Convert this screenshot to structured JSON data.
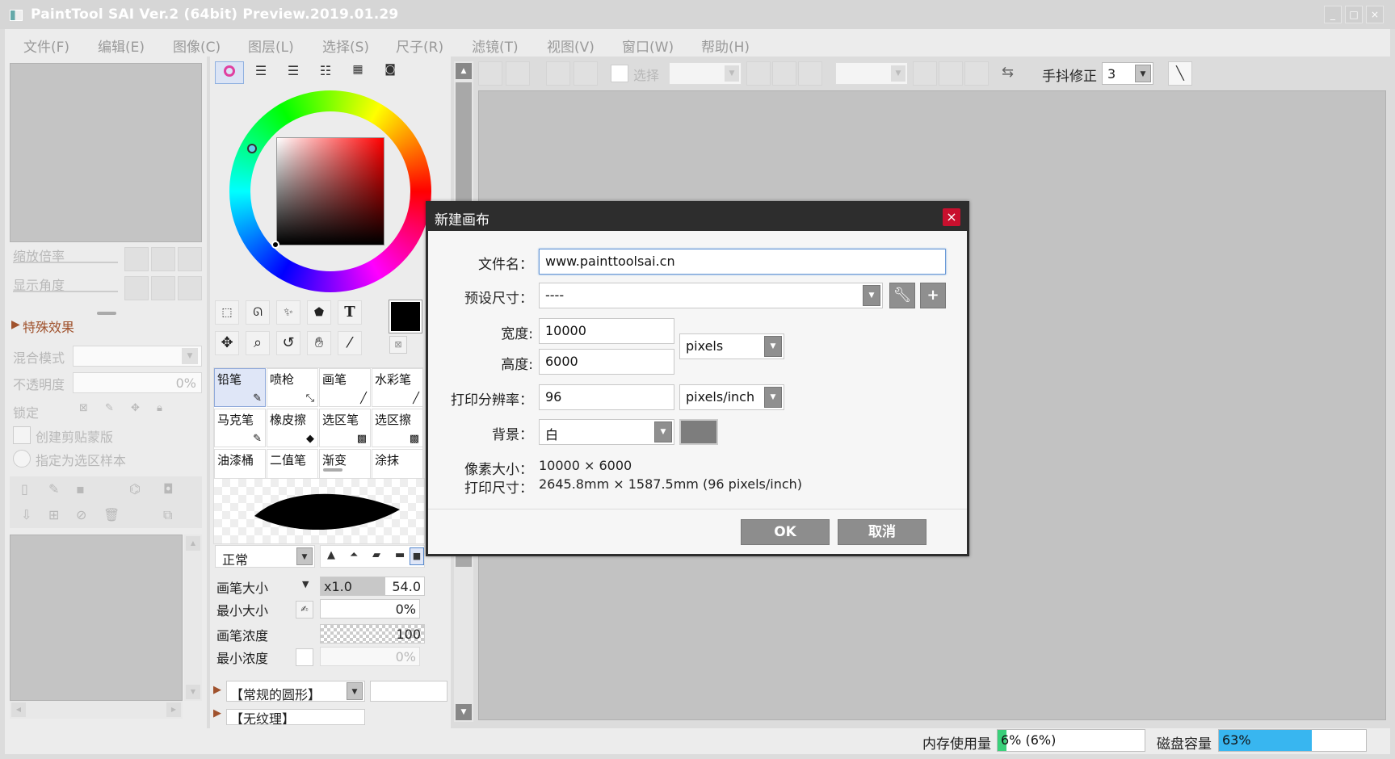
{
  "window": {
    "title": "PaintTool SAI Ver.2 (64bit) Preview.2019.01.29",
    "controls": [
      "_",
      "□",
      "×"
    ]
  },
  "menu": [
    "文件(F)",
    "编辑(E)",
    "图像(C)",
    "图层(L)",
    "选择(S)",
    "尺子(R)",
    "滤镜(T)",
    "视图(V)",
    "窗口(W)",
    "帮助(H)"
  ],
  "toolbar": {
    "select_label": "选择",
    "stabilizer_label": "手抖修正",
    "stabilizer_value": "3"
  },
  "navigator": {
    "zoom_label": "缩放倍率",
    "angle_label": "显示角度"
  },
  "layer_panel": {
    "effects_label": "特殊效果",
    "blend_label": "混合模式",
    "opacity_label": "不透明度",
    "opacity_value": "0%",
    "lock_label": "锁定",
    "clip_label": "创建剪贴蒙版",
    "sample_label": "指定为选区样本"
  },
  "brushes": {
    "row1": [
      "铅笔",
      "喷枪",
      "画笔",
      "水彩笔"
    ],
    "row2": [
      "马克笔",
      "橡皮擦",
      "选区笔",
      "选区擦"
    ],
    "row3": [
      "油漆桶",
      "二值笔",
      "渐变",
      "涂抹"
    ]
  },
  "brush_settings": {
    "mode": "正常",
    "size_label": "画笔大小",
    "size_mult": "x1.0",
    "size_value": "54.0",
    "min_size_label": "最小大小",
    "min_size_value": "0%",
    "density_label": "画笔浓度",
    "density_value": "100",
    "min_density_label": "最小浓度",
    "min_density_value": "0%",
    "shape": "【常规的圆形】",
    "texture": "【无纹理】"
  },
  "dialog": {
    "title": "新建画布",
    "filename_label": "文件名：",
    "filename_value": "www.painttoolsai.cn",
    "preset_label": "预设尺寸：",
    "preset_value": "----",
    "width_label": "宽度:",
    "width_value": "10000",
    "height_label": "高度:",
    "height_value": "6000",
    "unit": "pixels",
    "resolution_label": "打印分辨率：",
    "resolution_value": "96",
    "resolution_unit": "pixels/inch",
    "background_label": "背景：",
    "background_value": "白",
    "pixel_size_label": "像素大小：",
    "pixel_size_value": "10000 × 6000",
    "print_size_label": "打印尺寸：",
    "print_size_value": "2645.8mm × 1587.5mm (96 pixels/inch)",
    "ok_label": "OK",
    "cancel_label": "取消"
  },
  "status": {
    "memory_label": "内存使用量",
    "memory_value": "6% (6%)",
    "memory_percent": 6,
    "disk_label": "磁盘容量",
    "disk_value": "63%",
    "disk_percent": 63
  },
  "colors": {
    "accent_memory": "#3ad07a",
    "accent_disk": "#38b6f0",
    "close_red": "#c8102e",
    "dialog_dark": "#2d2d2d"
  }
}
